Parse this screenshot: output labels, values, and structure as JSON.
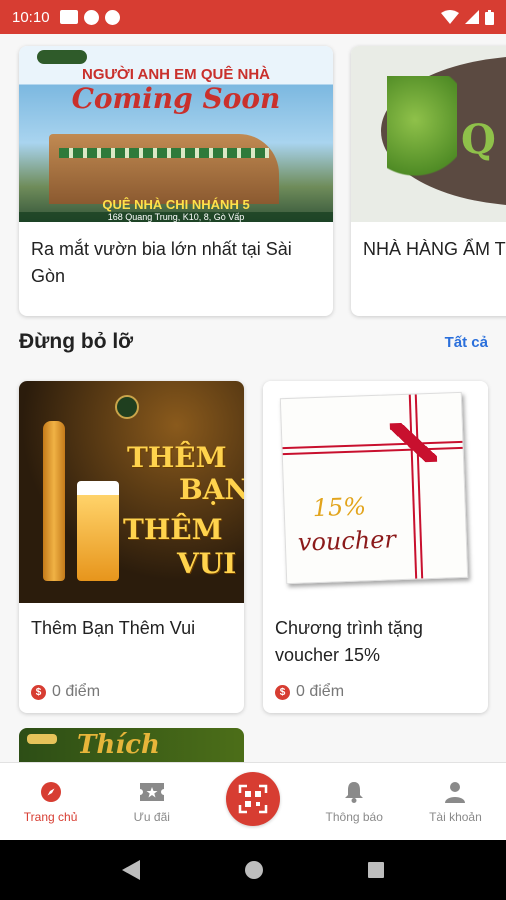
{
  "status_bar": {
    "time": "10:10"
  },
  "news": [
    {
      "title": "Ra mắt vườn bia lớn nhất tại Sài Gòn",
      "image_text": {
        "headline": "NGƯỜI ANH EM QUÊ NHÀ",
        "coming": "Coming Soon",
        "branch": "QUÊ NHÀ CHI NHÁNH 5",
        "address": "168 Quang Trung, K10, 8, Gò Vấp"
      }
    },
    {
      "title": "NHÀ HÀNG ẨM T THÔNG BÁO",
      "image_text": {
        "mark": "Q"
      }
    }
  ],
  "section": {
    "title": "Đừng bỏ lỡ",
    "see_all": "Tất cả"
  },
  "promos": [
    {
      "title": "Thêm Bạn Thêm Vui",
      "points": "0 điểm",
      "image_text": {
        "line1a": "THÊM",
        "line1b": "BẠN",
        "line2a": "THÊM",
        "line2b": "VUI"
      }
    },
    {
      "title": "Chương trình tặng voucher 15%",
      "points": "0 điểm",
      "image_text": {
        "pct": "15%",
        "voucher": "voucher"
      }
    }
  ],
  "promo3_partial": {
    "image_text": "Thích"
  },
  "coin_symbol": "$",
  "nav": [
    {
      "label": "Trang chủ",
      "icon": "compass-icon",
      "active": true
    },
    {
      "label": "Ưu đãi",
      "icon": "ticket-star-icon",
      "active": false
    },
    {
      "label": "",
      "icon": "qr-scan-icon",
      "active": false
    },
    {
      "label": "Thông báo",
      "icon": "bell-icon",
      "active": false
    },
    {
      "label": "Tài khoản",
      "icon": "user-icon",
      "active": false
    }
  ],
  "colors": {
    "brand": "#d73d32",
    "link": "#2a6fdb"
  }
}
